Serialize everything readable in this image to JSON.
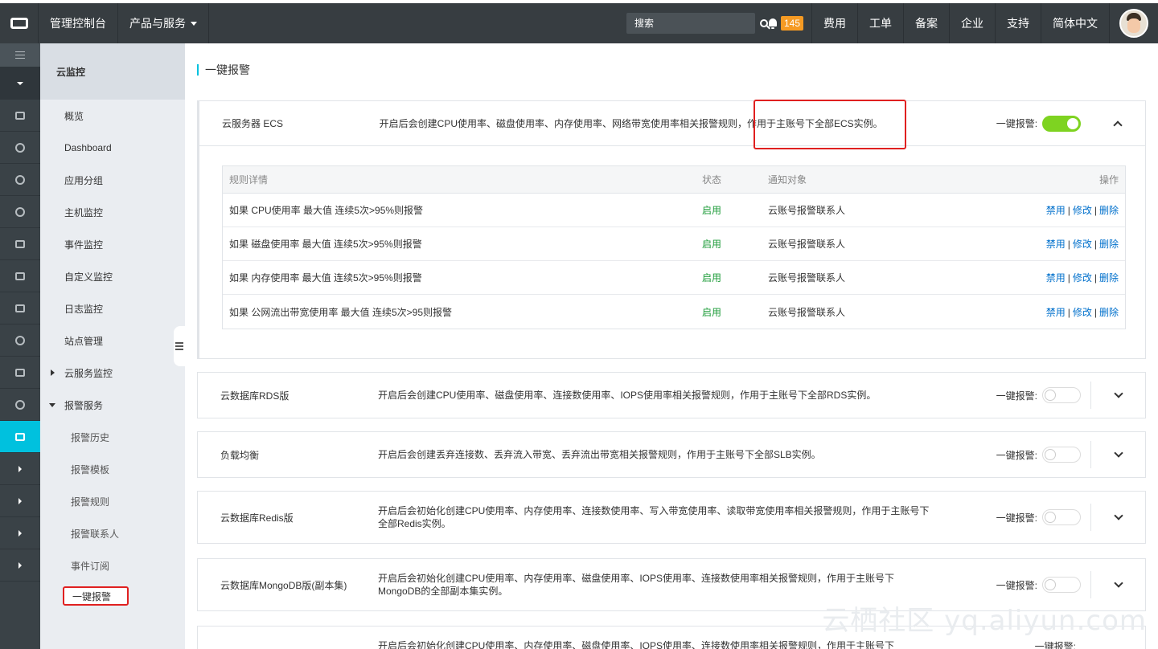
{
  "topbar": {
    "console": "管理控制台",
    "products": "产品与服务",
    "search_placeholder": "搜索",
    "badge": "145",
    "links": [
      "费用",
      "工单",
      "备案",
      "企业",
      "支持",
      "简体中文"
    ]
  },
  "sidebar": {
    "title": "云监控",
    "items": [
      "概览",
      "Dashboard",
      "应用分组",
      "主机监控",
      "事件监控",
      "自定义监控",
      "日志监控",
      "站点管理"
    ],
    "group_cloud": "云服务监控",
    "group_alarm": "报警服务",
    "alarm_items": [
      "报警历史",
      "报警模板",
      "报警规则",
      "报警联系人",
      "事件订阅"
    ],
    "current": "一键报警"
  },
  "main": {
    "title": "一键报警",
    "switch_label": "一键报警:",
    "rules_header": {
      "detail": "规则详情",
      "state": "状态",
      "notify": "通知对象",
      "ops": "操作"
    },
    "ops": {
      "disable": "禁用",
      "edit": "修改",
      "delete": "删除"
    },
    "ecs": {
      "name": "云服务器 ECS",
      "desc": "开启后会创建CPU使用率、磁盘使用率、内存使用率、网络带宽使用率相关报警规则，作用于主账号下全部ECS实例。",
      "rules": [
        {
          "detail": "如果 CPU使用率 最大值 连续5次>95%则报警",
          "state": "启用",
          "notify": "云账号报警联系人"
        },
        {
          "detail": "如果 磁盘使用率 最大值 连续5次>95%则报警",
          "state": "启用",
          "notify": "云账号报警联系人"
        },
        {
          "detail": "如果 内存使用率 最大值 连续5次>95%则报警",
          "state": "启用",
          "notify": "云账号报警联系人"
        },
        {
          "detail": "如果 公网流出带宽使用率 最大值 连续5次>95则报警",
          "state": "启用",
          "notify": "云账号报警联系人"
        }
      ]
    },
    "rds": {
      "name": "云数据库RDS版",
      "desc": "开启后会创建CPU使用率、磁盘使用率、连接数使用率、IOPS使用率相关报警规则，作用于主账号下全部RDS实例。"
    },
    "slb": {
      "name": "负载均衡",
      "desc": "开启后会创建丢弃连接数、丢弃流入带宽、丢弃流出带宽相关报警规则，作用于主账号下全部SLB实例。"
    },
    "redis": {
      "name": "云数据库Redis版",
      "desc": "开启后会初始化创建CPU使用率、内存使用率、连接数使用率、写入带宽使用率、读取带宽使用率相关报警规则，作用于主账号下全部Redis实例。"
    },
    "mongo": {
      "name": "云数据库MongoDB版(副本集)",
      "desc": "开启后会初始化创建CPU使用率、内存使用率、磁盘使用率、IOPS使用率、连接数使用率相关报警规则，作用于主账号下MongoDB的全部副本集实例。"
    },
    "mongo2": {
      "desc": "开启后会初始化创建CPU使用率、内存使用率、磁盘使用率、IOPS使用率、连接数使用率相关报警规则，作用于主账号下"
    }
  },
  "watermark": "云栖社区 yq.aliyun.com",
  "colors": {
    "accent": "#00c1de",
    "switch_on": "#7ed321",
    "highlight": "#e02020",
    "link": "#0070cc"
  }
}
